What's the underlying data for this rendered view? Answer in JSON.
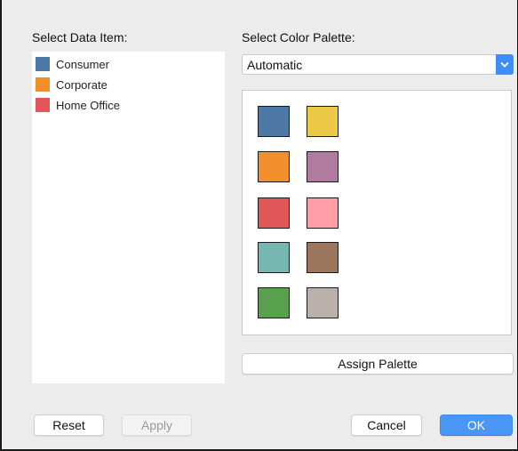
{
  "left_panel": {
    "label": "Select Data Item:",
    "items": [
      {
        "label": "Consumer",
        "color": "#4e79a7"
      },
      {
        "label": "Corporate",
        "color": "#f28e2b"
      },
      {
        "label": "Home Office",
        "color": "#e15759"
      }
    ]
  },
  "right_panel": {
    "label": "Select Color Palette:",
    "palette_select": {
      "value": "Automatic",
      "icon": "chevron-down-icon"
    },
    "palette_colors": [
      "#4e79a7",
      "#edc948",
      "#f28e2b",
      "#b07aa1",
      "#e15759",
      "#ff9da7",
      "#76b7b2",
      "#9c755f",
      "#59a14f",
      "#bab0ac"
    ],
    "assign_button": "Assign Palette"
  },
  "footer": {
    "reset": "Reset",
    "apply": "Apply",
    "cancel": "Cancel",
    "ok": "OK"
  }
}
